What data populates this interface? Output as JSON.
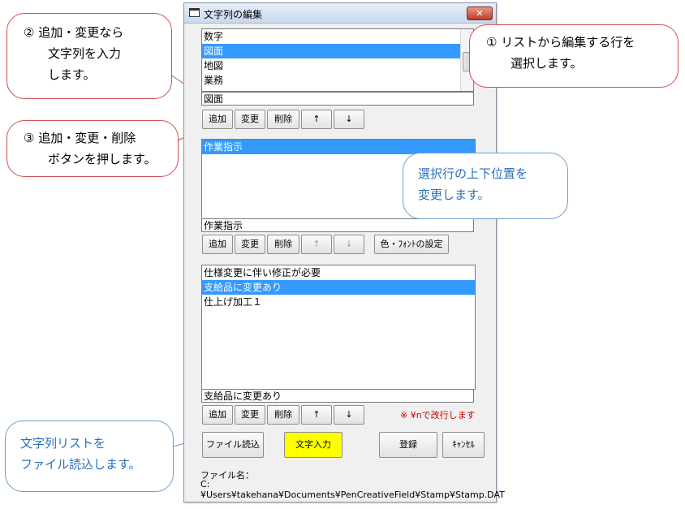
{
  "window": {
    "title": "文字列の編集",
    "close_label": "✕"
  },
  "list1": {
    "items": [
      "数字",
      "図面",
      "地図",
      "業務"
    ],
    "selected_index": 1,
    "edit_value": "図面"
  },
  "list2": {
    "items": [
      "作業指示"
    ],
    "selected_index": 0,
    "edit_value": "作業指示"
  },
  "list3": {
    "items": [
      "仕様変更に伴い修正が必要",
      "支給品に変更あり",
      "仕上げ加工１"
    ],
    "selected_index": 1,
    "edit_value": "支給品に変更あり"
  },
  "buttons": {
    "add": "追加",
    "change": "変更",
    "delete": "削除",
    "up": "↑",
    "down": "↓",
    "color_font": "色・ﾌｫﾝﾄの設定",
    "file_read": "ファイル読込",
    "text_input": "文字入力",
    "register": "登録",
    "cancel": "ｷｬﾝｾﾙ"
  },
  "note": "※ ¥nで改行します",
  "filename": {
    "label": "ファイル名：",
    "path": "C:¥Users¥takehana¥Documents¥PenCreativeField¥Stamp¥Stamp.DAT"
  },
  "callouts": {
    "c1": {
      "line1": "①  リストから編集する行を",
      "line2": "選択します。"
    },
    "c2": {
      "line1": "②  追加・変更なら",
      "line2": "文字列を入力",
      "line3": "します。"
    },
    "c3": {
      "line1": "③  追加・変更・削除",
      "line2": "ボタンを押します。"
    },
    "c4": {
      "line1": "選択行の上下位置を",
      "line2": "変更します。"
    },
    "c5": {
      "line1": "文字列リストを",
      "line2": "ファイル読込します。"
    }
  },
  "colors": {
    "selection": "#3399ff",
    "callout_red": "#d05050",
    "callout_blue": "#6a9fd0",
    "yellow_button": "#ffff00",
    "note_red": "#c00000"
  }
}
